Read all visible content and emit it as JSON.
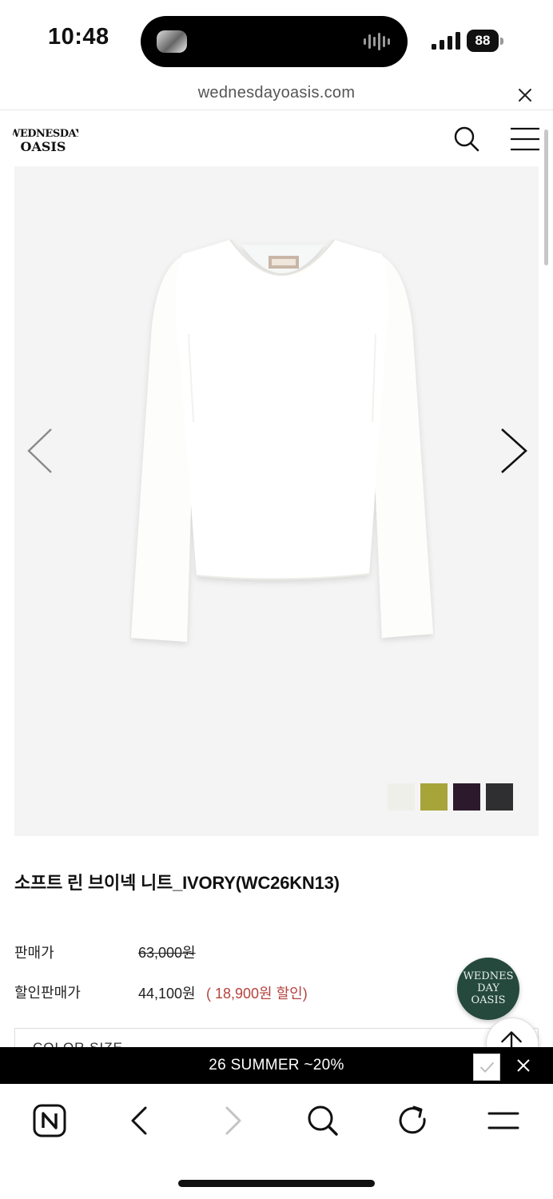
{
  "status_bar": {
    "time": "10:48",
    "battery": "88"
  },
  "browser": {
    "url": "wednesdayoasis.com"
  },
  "site": {
    "logo_line1": "WEDNESDAY",
    "logo_line2": "OASIS"
  },
  "product": {
    "title": "소프트 린 브이넥 니트_IVORY(WC26KN13)",
    "price_label": "판매가",
    "price": "63,000원",
    "sale_label": "할인판매가",
    "sale_price": "44,100원",
    "discount": "( 18,900원 할인)",
    "option_text": "COLOR SIZE",
    "swatches": [
      {
        "name": "ivory",
        "color": "#efefea"
      },
      {
        "name": "olive",
        "color": "#a7a43a"
      },
      {
        "name": "plum",
        "color": "#2c1a2c"
      },
      {
        "name": "charcoal",
        "color": "#2f2f31"
      }
    ]
  },
  "chat_logo": [
    "WEDNES",
    "DAY",
    "OASIS"
  ],
  "promo": {
    "text": "26 SUMMER ~20%"
  },
  "toolbar": {
    "icons": [
      "naver-icon",
      "back-icon",
      "forward-icon",
      "search-icon",
      "reload-icon",
      "menu-icon"
    ]
  }
}
